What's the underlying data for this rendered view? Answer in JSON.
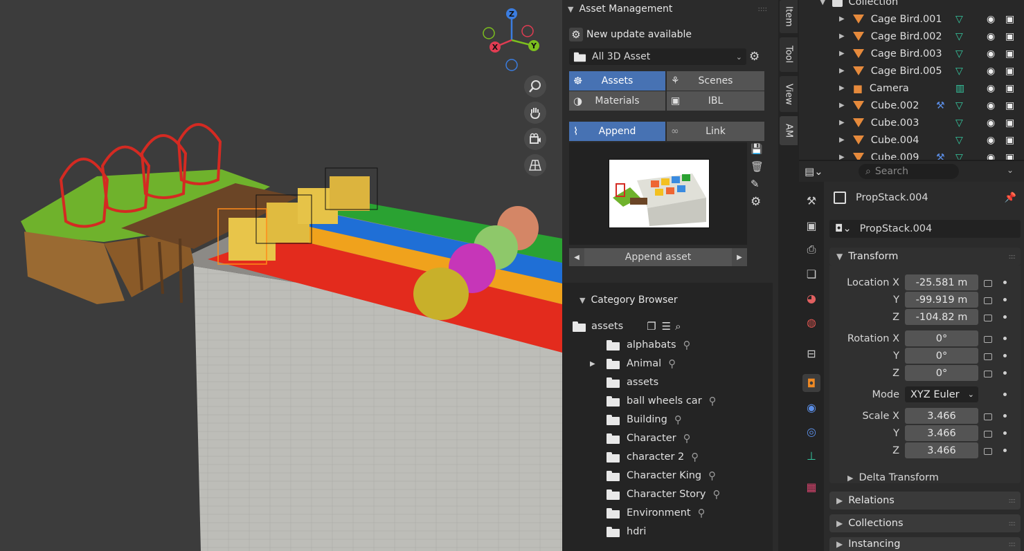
{
  "asset_panel": {
    "header": "Asset Management",
    "update_notice": "New update available",
    "library_dropdown": "All 3D Asset",
    "type_tabs": [
      "Assets",
      "Scenes",
      "Materials",
      "IBL"
    ],
    "import_modes": [
      "Append",
      "Link"
    ],
    "append_button": "Append asset",
    "category_header": "Category Browser",
    "root_folder": "assets",
    "categories": [
      "alphabats",
      "Animal",
      "assets",
      "ball wheels car",
      "Building",
      "Character",
      "character 2",
      "Character King",
      "Character Story",
      "Environment",
      "hdri"
    ]
  },
  "sidebar_tabs": [
    "Item",
    "Tool",
    "View",
    "AM"
  ],
  "outliner": {
    "collection": "Collection",
    "items": [
      "Cage Bird.001",
      "Cage Bird.002",
      "Cage Bird.003",
      "Cage Bird.005",
      "Camera",
      "Cube.002",
      "Cube.003",
      "Cube.004",
      "Cube.009"
    ]
  },
  "properties": {
    "search_placeholder": "Search",
    "object_name": "PropStack.004",
    "object_field": "PropStack.004",
    "transform_header": "Transform",
    "location_label": "Location X",
    "location": [
      "-25.581 m",
      "-99.919 m",
      "-104.82 m"
    ],
    "rotation_label": "Rotation X",
    "rotation": [
      "0°",
      "0°",
      "0°"
    ],
    "axis_y": "Y",
    "axis_z": "Z",
    "mode_label": "Mode",
    "mode_value": "XYZ Euler",
    "scale_label": "Scale X",
    "scale": [
      "3.466",
      "3.466",
      "3.466"
    ],
    "delta_transform": "Delta Transform",
    "relations": "Relations",
    "collections": "Collections",
    "instancing": "Instancing"
  },
  "gizmo": {
    "x": "X",
    "y": "Y",
    "z": "Z"
  },
  "colors": {
    "accent": "#4772b3",
    "object_orange": "#e68a3c",
    "panel_bg": "#2b2b2b",
    "viewport_bg": "#3c3c3c"
  }
}
